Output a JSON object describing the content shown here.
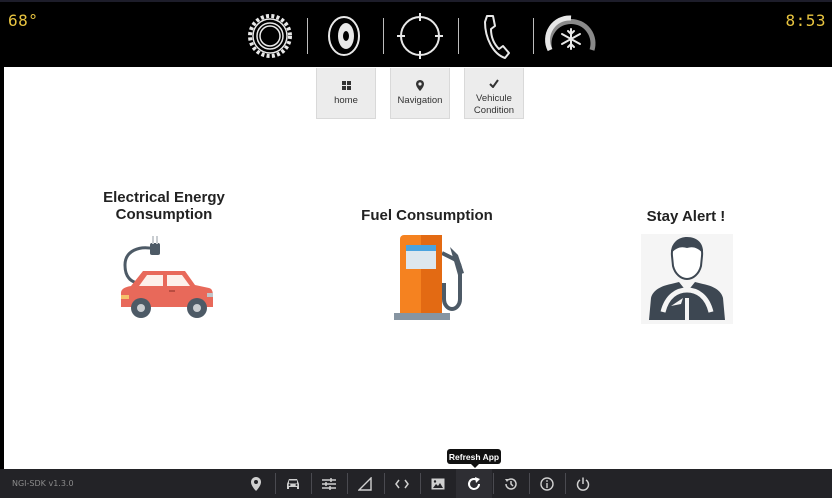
{
  "status": {
    "temperature": "68°",
    "time": "8:53"
  },
  "top_icons": [
    "settings-gear-icon",
    "media-disc-icon",
    "target-crosshair-icon",
    "phone-icon",
    "climate-fan-icon"
  ],
  "nav": [
    {
      "label": "home",
      "icon": "grid-icon"
    },
    {
      "label": "Navigation",
      "icon": "map-pin-icon"
    },
    {
      "label": "Vehicule Condition",
      "icon": "checkmark-icon"
    }
  ],
  "sections": [
    {
      "title": "Electrical Energy Consumption",
      "icon": "electric-car-icon"
    },
    {
      "title": "Fuel Consumption",
      "icon": "fuel-pump-icon"
    },
    {
      "title": "Stay Alert !",
      "icon": "driver-icon"
    }
  ],
  "bottom": {
    "version": "NGI-SDK v1.3.0",
    "tooltip": "Refresh App",
    "icons": [
      "location-icon",
      "car-icon",
      "sliders-icon",
      "signal-icon",
      "code-icon",
      "image-icon",
      "refresh-icon",
      "history-icon",
      "info-icon",
      "power-icon"
    ]
  },
  "colors": {
    "accent_clock": "#e8c440",
    "topbar": "#000000",
    "bottombar": "#232327",
    "car_red": "#e8695a",
    "fuel_orange": "#f58220"
  }
}
